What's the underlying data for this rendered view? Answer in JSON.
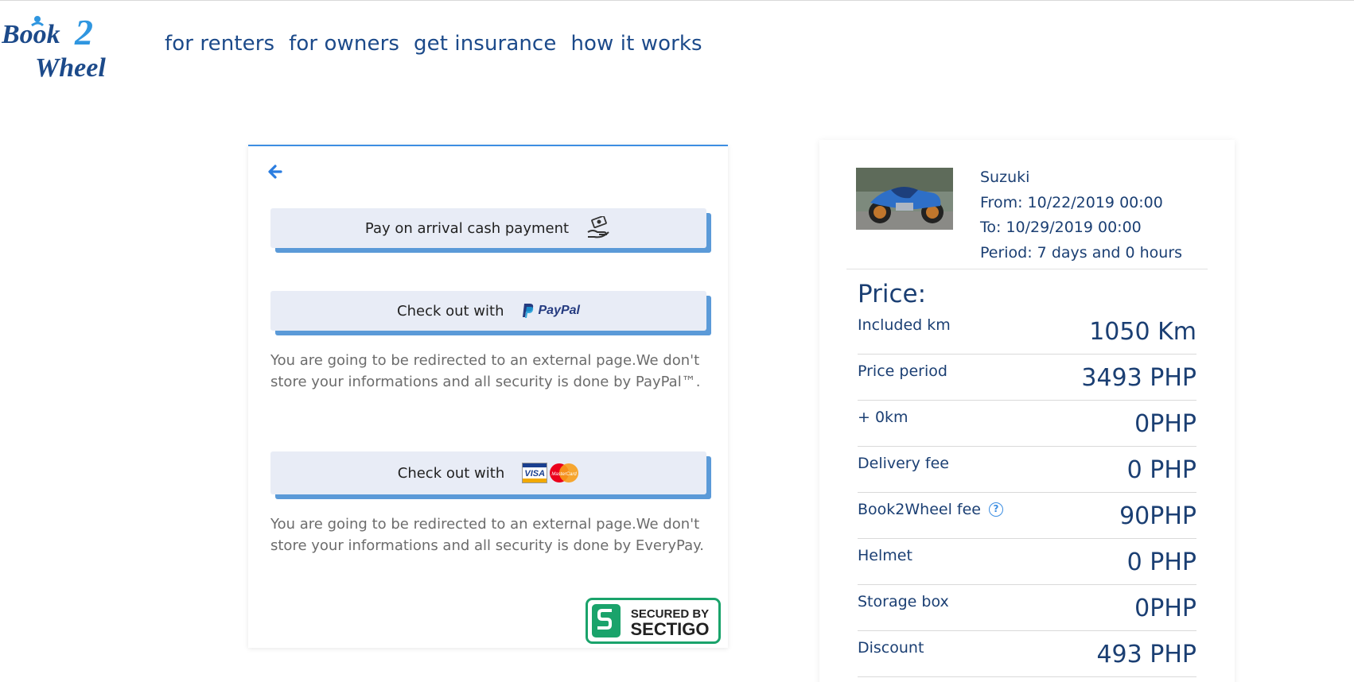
{
  "brand": {
    "logo_text_top": "Book",
    "logo_text_num": "2",
    "logo_text_bottom": "Wheel"
  },
  "nav": [
    {
      "label": "for renters"
    },
    {
      "label": "for owners"
    },
    {
      "label": "get insurance"
    },
    {
      "label": "how it works"
    }
  ],
  "payment": {
    "cash_label": "Pay on arrival cash payment",
    "paypal_label": "Check out with",
    "paypal_brand": "PayPal",
    "paypal_note": "You are going to be redirected to an external page.We don't store your informations and all security is done by PayPal™.",
    "card_label": "Check out with",
    "card_note": "You are going to be redirected to an external page.We don't store your informations and all security is done by EveryPay.",
    "badge_line1": "SECURED BY",
    "badge_line2": "SECTIGO",
    "card_brand_visa": "VISA",
    "card_brand_mc": "MasterCard"
  },
  "summary": {
    "bike_name": "Suzuki",
    "from": "From: 10/22/2019 00:00",
    "to": "To: 10/29/2019 00:00",
    "period": "Period: 7 days and 0 hours",
    "price_title": "Price:",
    "rows": [
      {
        "label": "Included km",
        "value": "1050 Km"
      },
      {
        "label": "Price period",
        "value": "3493 PHP"
      },
      {
        "label": "+ 0km",
        "value": "0PHP"
      },
      {
        "label": "Delivery fee",
        "value": "0 PHP"
      },
      {
        "label": "Book2Wheel fee",
        "value": "90PHP"
      },
      {
        "label": "Helmet",
        "value": "0 PHP"
      },
      {
        "label": "Storage box",
        "value": "0PHP"
      },
      {
        "label": "Discount",
        "value": "493 PHP"
      }
    ]
  },
  "colors": {
    "accent": "#3d8ee2",
    "navy": "#1b3f73",
    "button_bg": "#e8ecf6",
    "button_shadow": "#5b9ad8",
    "sectigo_green": "#1aa36b"
  },
  "icons": [
    "back-arrow-icon",
    "cash-hand-icon",
    "paypal-logo",
    "visa-logo",
    "mastercard-logo",
    "sectigo-badge",
    "help-icon"
  ]
}
